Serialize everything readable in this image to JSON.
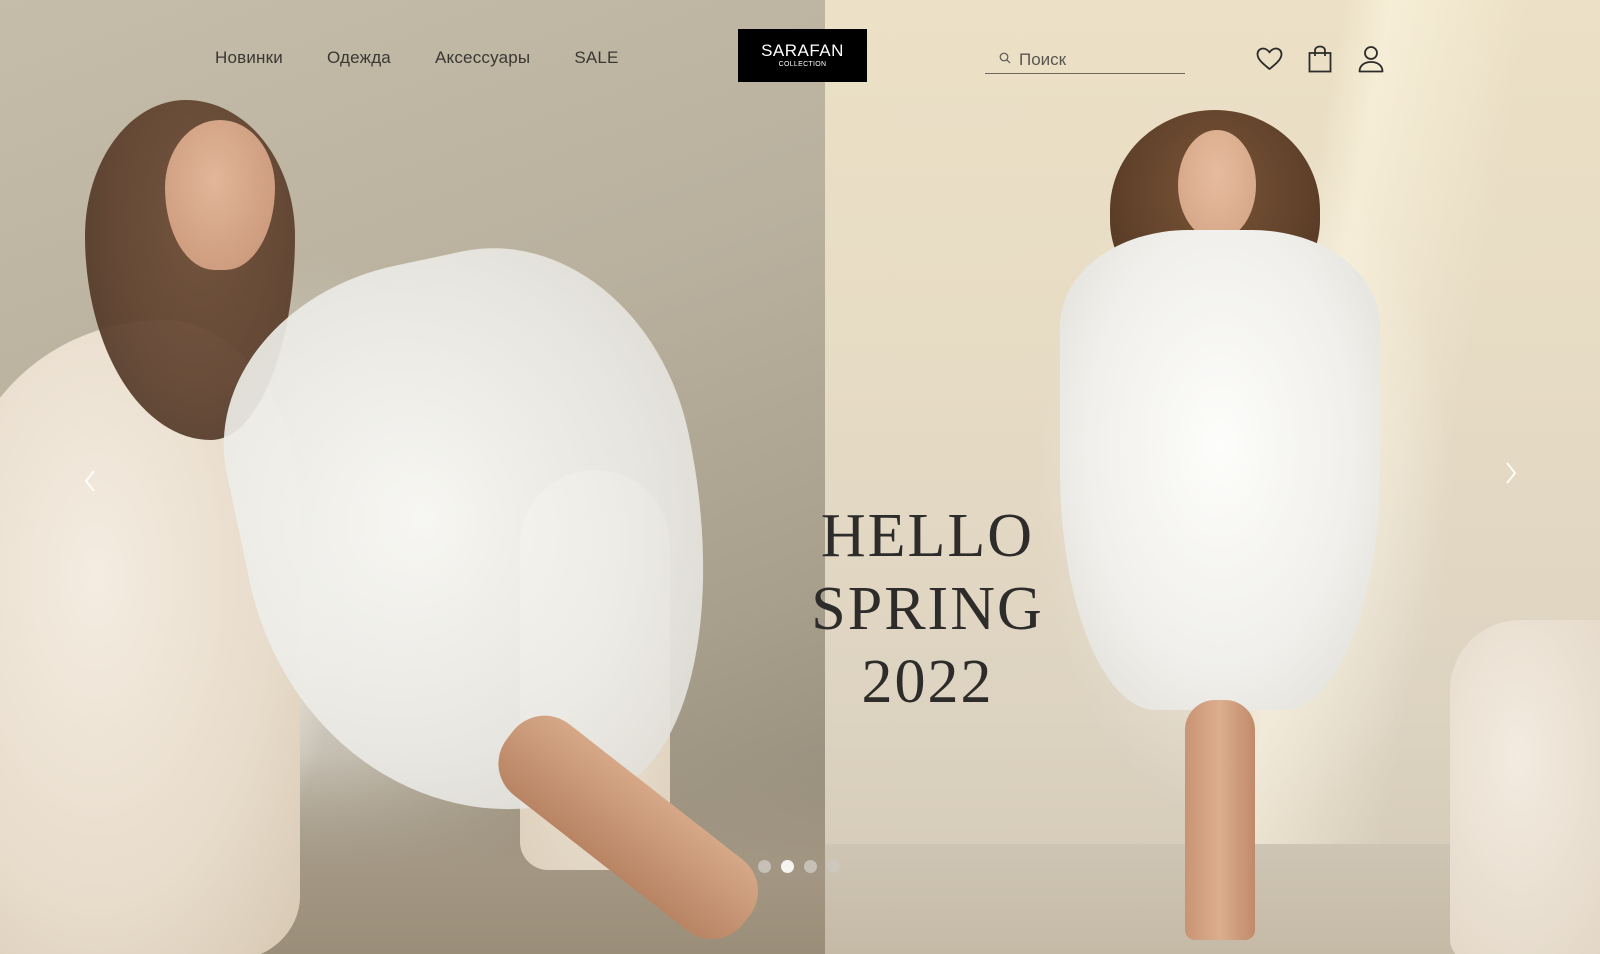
{
  "nav": {
    "items": [
      {
        "label": "Новинки"
      },
      {
        "label": "Одежда"
      },
      {
        "label": "Аксессуары"
      },
      {
        "label": "SALE"
      }
    ]
  },
  "logo": {
    "main": "SARAFAN",
    "sub": "COLLECTION"
  },
  "search": {
    "placeholder": "Поиск",
    "value": ""
  },
  "header_icons": [
    "heart-icon",
    "shopping-bag-icon",
    "user-icon"
  ],
  "hero": {
    "title_line1": "HELLO SPRING",
    "title_line2": "2022"
  },
  "slider": {
    "slide_count": 4,
    "active_index": 1
  },
  "colors": {
    "logo_bg": "#000000",
    "text": "#3a3733",
    "title": "#2e2c2a",
    "dot_active": "#f6f4f0",
    "dot_inactive": "#cdc8c1"
  }
}
